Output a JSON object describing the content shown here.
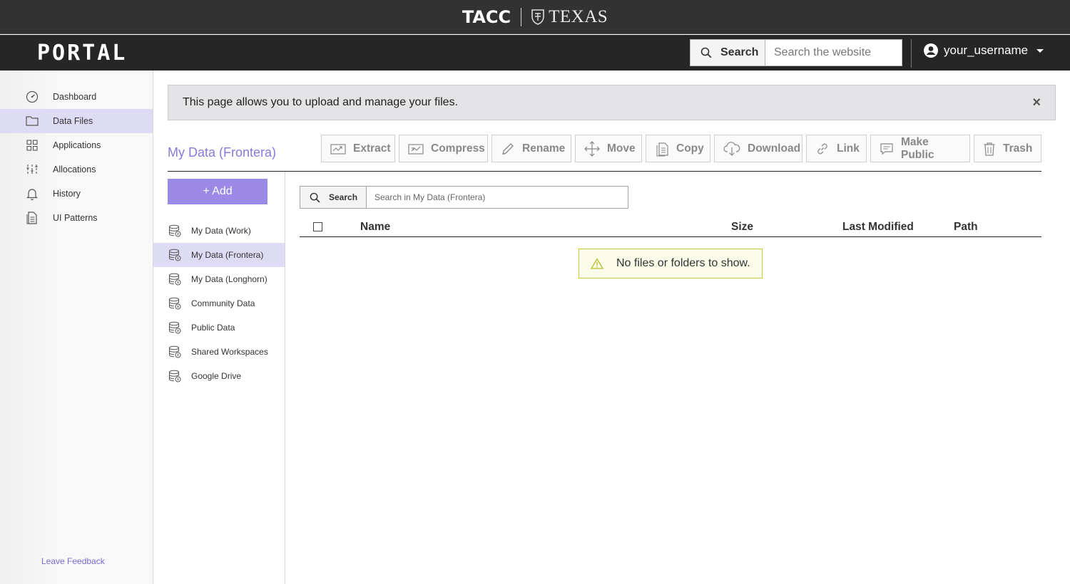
{
  "header": {
    "brand_primary": "TACC",
    "brand_secondary": "TEXAS",
    "portal_name": "PORTAL",
    "search_label": "Search",
    "search_placeholder": "Search the website",
    "username": "your_username"
  },
  "sidebar": {
    "items": [
      {
        "label": "Dashboard",
        "icon": "dashboard-icon",
        "active": false
      },
      {
        "label": "Data Files",
        "icon": "folder-icon",
        "active": true
      },
      {
        "label": "Applications",
        "icon": "applications-icon",
        "active": false
      },
      {
        "label": "Allocations",
        "icon": "allocations-icon",
        "active": false
      },
      {
        "label": "History",
        "icon": "bell-icon",
        "active": false
      },
      {
        "label": "UI Patterns",
        "icon": "document-icon",
        "active": false
      }
    ],
    "feedback_label": "Leave Feedback"
  },
  "notice": {
    "text": "This page allows you to upload and manage your files.",
    "close": "×"
  },
  "main": {
    "heading": "My Data (Frontera)",
    "add_label": "+ Add",
    "toolbar": [
      {
        "label": "Extract",
        "icon": "extract-icon"
      },
      {
        "label": "Compress",
        "icon": "compress-icon"
      },
      {
        "label": "Rename",
        "icon": "pencil-icon"
      },
      {
        "label": "Move",
        "icon": "move-icon"
      },
      {
        "label": "Copy",
        "icon": "copy-icon"
      },
      {
        "label": "Download",
        "icon": "cloud-download-icon"
      },
      {
        "label": "Link",
        "icon": "link-icon"
      },
      {
        "label": "Make Public",
        "icon": "make-public-icon"
      },
      {
        "label": "Trash",
        "icon": "trash-icon"
      }
    ],
    "systems": [
      {
        "label": "My Data (Work)",
        "active": false
      },
      {
        "label": "My Data (Frontera)",
        "active": true
      },
      {
        "label": "My Data (Longhorn)",
        "active": false
      },
      {
        "label": "Community Data",
        "active": false
      },
      {
        "label": "Public Data",
        "active": false
      },
      {
        "label": "Shared Workspaces",
        "active": false
      },
      {
        "label": "Google Drive",
        "active": false
      }
    ],
    "file_search": {
      "label": "Search",
      "placeholder": "Search in My Data (Frontera)"
    },
    "table": {
      "columns": [
        "Name",
        "Size",
        "Last Modified",
        "Path"
      ]
    },
    "empty_message": "No files or folders to show."
  },
  "colors": {
    "accent": "#8c78dc",
    "add_button": "#9b89e6",
    "active_bg": "#dedbf5",
    "header_bg": "#323232",
    "navbar_bg": "#262626"
  }
}
